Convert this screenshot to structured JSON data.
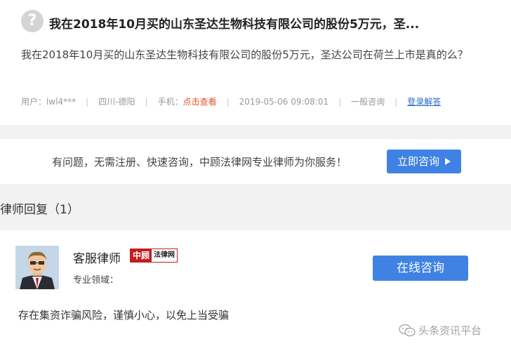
{
  "question": {
    "title": "我在2018年10月买的山东圣达生物科技有限公司的股份5万元，圣...",
    "body": "我在2018年10月买的山东圣达生物科技有限公司的股份5万元，圣达公司在荷兰上市是真的么？",
    "meta": {
      "user": "用户：lwl4***",
      "location": "四川-德阳",
      "phone_label": "手机：",
      "phone_link": "点击查看",
      "datetime": "2019-05-06 09:08:01",
      "category": "一般咨询",
      "login_link": "登录解答"
    }
  },
  "banner": {
    "text": "有问题，无需注册、快速咨询，中顾法律网专业律师为你服务！",
    "button_label": "立即咨询"
  },
  "reply_header": "律师回复（1）",
  "reply": {
    "lawyer_name": "客服律师",
    "logo_red": "中顾",
    "logo_white": "法律网",
    "field_label": "专业领域：",
    "button_label": "在线咨询",
    "text": "存在集资诈骗风险，谨慎小心，以免上当受骗"
  },
  "watermark": "头条资讯平台",
  "icons": {
    "question": "question-mark-icon",
    "play": "play-triangle-icon",
    "wechat": "wechat-icon"
  }
}
